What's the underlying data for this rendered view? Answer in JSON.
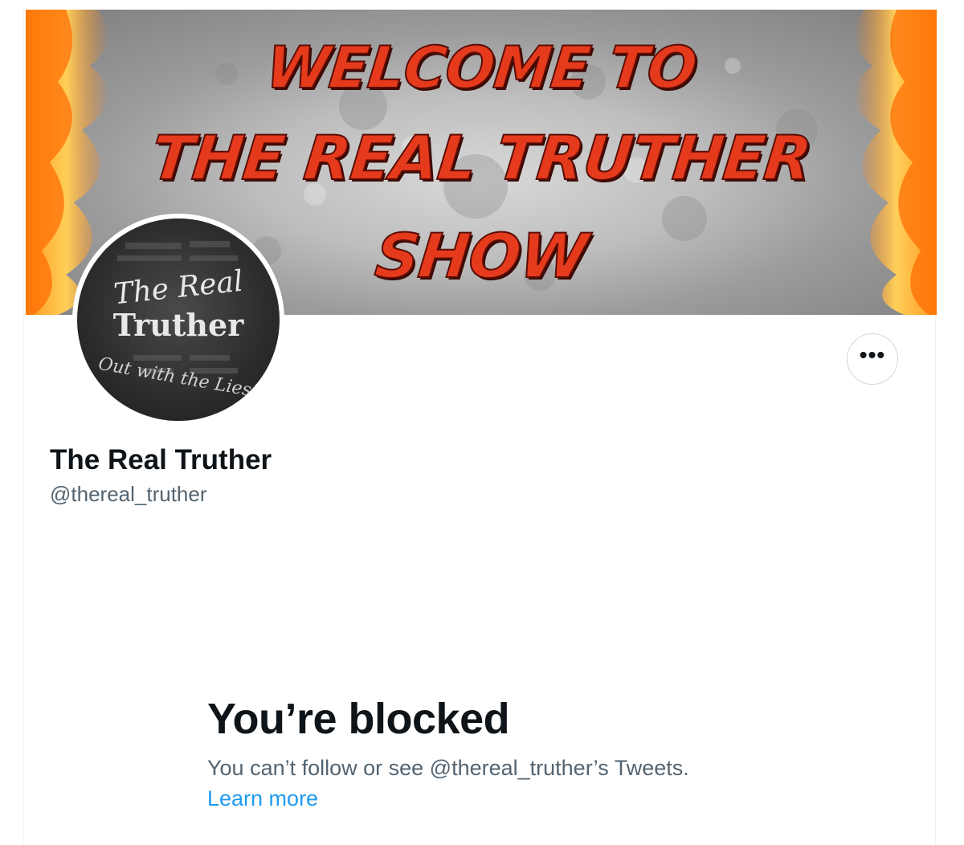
{
  "banner": {
    "line1": "WELCOME TO",
    "line2": "THE REAL TRUTHER",
    "line3": "SHOW"
  },
  "avatar": {
    "line1": "The Real",
    "line2": "Truther",
    "tagline": "Out with the Lies!"
  },
  "profile": {
    "display_name": "The Real Truther",
    "handle": "@thereal_truther",
    "more_icon": "more-horizontal-icon",
    "more_label": "•••"
  },
  "blocked": {
    "title": "You’re blocked",
    "description": "You can’t follow or see @thereal_truther’s Tweets.",
    "link": "Learn more"
  },
  "colors": {
    "banner_text": "#e53a1c",
    "link": "#1d9bf0",
    "secondary_text": "#536471",
    "primary_text": "#0f1419"
  }
}
